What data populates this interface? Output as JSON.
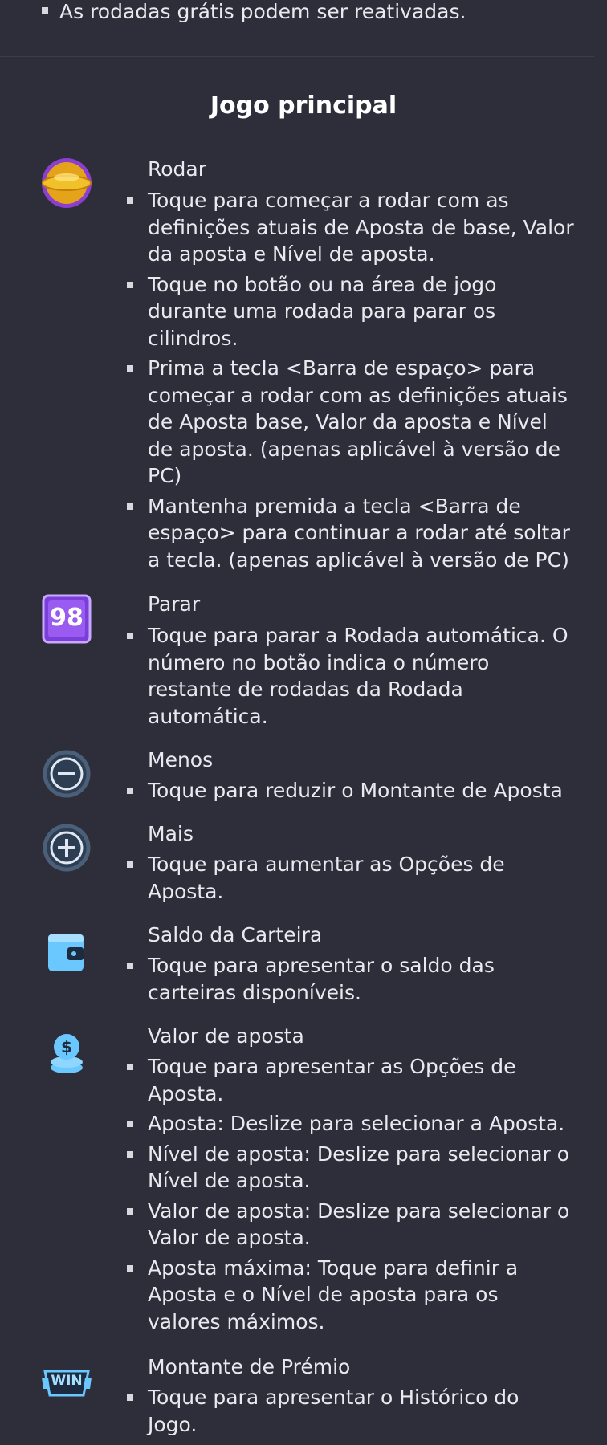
{
  "top_item": "As rodadas grátis podem ser reativadas.",
  "section_title": "Jogo principal",
  "entries": [
    {
      "title": "Rodar",
      "icon": "spin-icon",
      "items": [
        "Toque para começar a rodar com as\ndefinições atuais de Aposta de base, Valor\nda aposta e Nível de aposta.",
        "Toque no botão ou na área de jogo\ndurante uma rodada para parar os\ncilindros.",
        "Prima a tecla <Barra de espaço> para\ncomeçar a rodar com as definições atuais\nde Aposta base, Valor da aposta e Nível\nde aposta. (apenas aplicável à versão de\nPC)",
        "Mantenha premida a tecla <Barra de\nespaço> para continuar a rodar até soltar\na tecla. (apenas aplicável à versão de PC)"
      ]
    },
    {
      "title": "Parar",
      "icon": "stop-autospin-icon",
      "icon_text": "98",
      "items": [
        "Toque para parar a Rodada automática. O\nnúmero no botão indica o número\nrestante de rodadas da Rodada\nautomática."
      ]
    },
    {
      "title": "Menos",
      "icon": "minus-icon",
      "items": [
        "Toque para reduzir o Montante de Aposta"
      ]
    },
    {
      "title": "Mais",
      "icon": "plus-icon",
      "items": [
        "Toque para aumentar as Opções de\nAposta."
      ]
    },
    {
      "title": "Saldo da Carteira",
      "icon": "wallet-icon",
      "items": [
        "Toque para apresentar o saldo das\ncarteiras disponíveis."
      ]
    },
    {
      "title": "Valor de aposta",
      "icon": "coins-icon",
      "items": [
        "Toque para apresentar as Opções de\nAposta.",
        "Aposta: Deslize para selecionar a Aposta.",
        "Nível de aposta: Deslize para selecionar o\nNível de aposta.",
        "Valor de aposta: Deslize para selecionar o\nValor de aposta.",
        "Aposta máxima: Toque para definir a\nAposta e o Nível de aposta para os\nvalores máximos."
      ]
    },
    {
      "title": "Montante de Prémio",
      "icon": "win-icon",
      "icon_text": "WIN",
      "items": [
        "Toque para apresentar o Histórico do\nJogo."
      ]
    }
  ]
}
